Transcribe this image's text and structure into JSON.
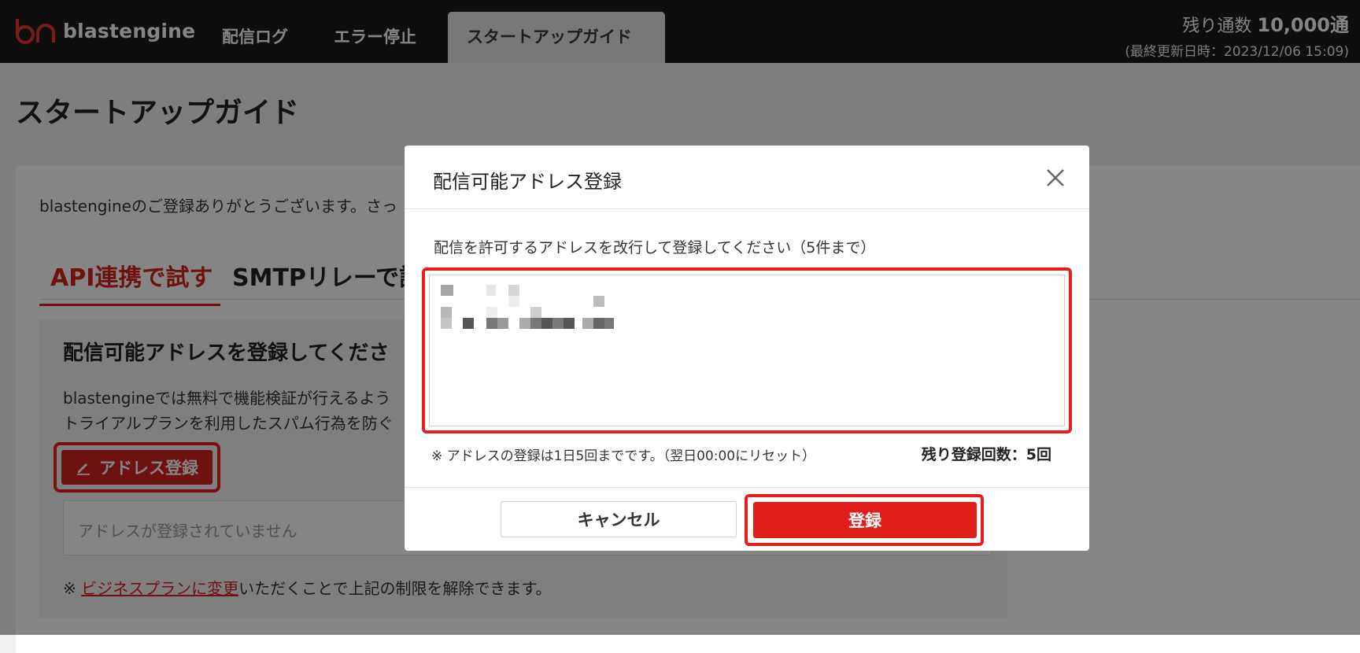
{
  "header": {
    "brand": "blastengine",
    "nav": [
      {
        "label": "配信ログ"
      },
      {
        "label": "エラー停止"
      },
      {
        "label": "スタートアップガイド"
      }
    ],
    "quota_label": "残り通数",
    "quota_value": "10,000通",
    "last_updated": "(最終更新日時：2023/12/06 15:09)"
  },
  "page": {
    "title": "スタートアップガイド",
    "intro": "blastengineのご登録ありがとうございます。さっ",
    "tabs": [
      {
        "label": "API連携で試す"
      },
      {
        "label": "SMTPリレーで試"
      }
    ],
    "section_title": "配信可能アドレスを登録してくださ",
    "desc_line1": "blastengineでは無料で機能検証が行えるよう",
    "desc_line2": "トライアルプランを利用したスパム行為を防ぐ",
    "register_button": "アドレス登録",
    "empty_message": "アドレスが登録されていません",
    "note_prefix": "※ ",
    "note_link": "ビジネスプランに変更",
    "note_suffix": "いただくことで上記の制限を解除できます。"
  },
  "modal": {
    "title": "配信可能アドレス登録",
    "label": "配信を許可するアドレスを改行して登録してください（5件まで）",
    "hint": "※ アドレスの登録は1日5回までです。（翌日00:00にリセット）",
    "remaining": "残り登録回数：5回",
    "cancel_button": "キャンセル",
    "submit_button": "登録"
  },
  "colors": {
    "brand_red": "#d3231f",
    "highlight_red": "#e81e1e",
    "topbar": "#1d1a1a"
  }
}
